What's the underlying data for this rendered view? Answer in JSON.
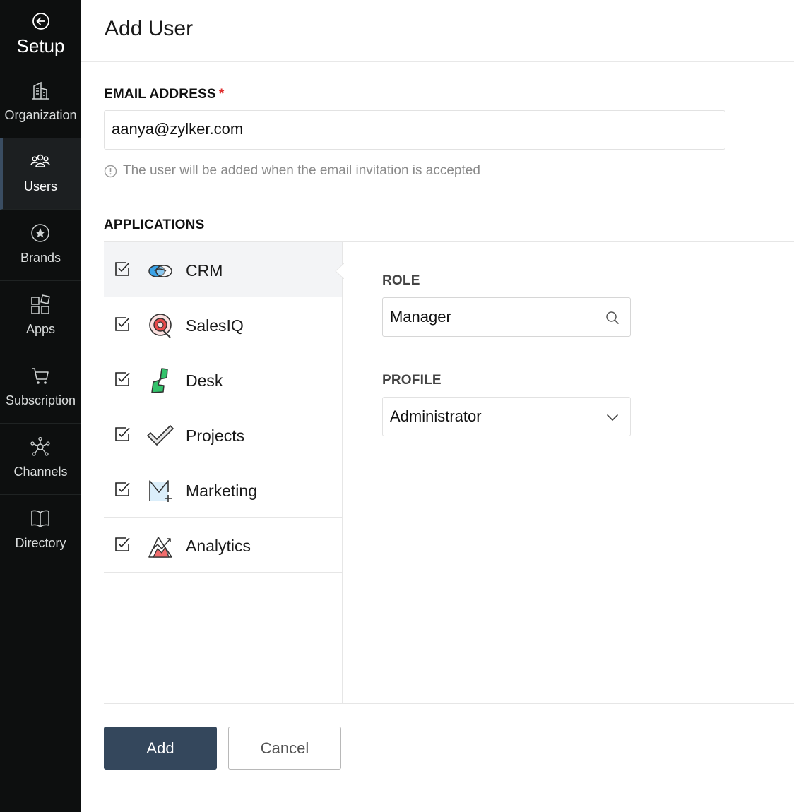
{
  "sidebar": {
    "setup_label": "Setup",
    "items": [
      {
        "label": "Organization",
        "icon": "building-icon"
      },
      {
        "label": "Users",
        "icon": "users-icon",
        "active": true
      },
      {
        "label": "Brands",
        "icon": "star-badge-icon"
      },
      {
        "label": "Apps",
        "icon": "apps-grid-icon"
      },
      {
        "label": "Subscription",
        "icon": "cart-icon"
      },
      {
        "label": "Channels",
        "icon": "network-icon"
      },
      {
        "label": "Directory",
        "icon": "book-icon"
      }
    ]
  },
  "header": {
    "title": "Add User"
  },
  "email": {
    "label": "EMAIL ADDRESS",
    "required_mark": "*",
    "value": "aanya@zylker.com",
    "hint": "The user will be added when the email invitation is accepted"
  },
  "applications": {
    "label": "APPLICATIONS",
    "items": [
      {
        "name": "CRM",
        "checked": true,
        "active": true
      },
      {
        "name": "SalesIQ",
        "checked": true
      },
      {
        "name": "Desk",
        "checked": true
      },
      {
        "name": "Projects",
        "checked": true
      },
      {
        "name": "Marketing",
        "checked": true
      },
      {
        "name": "Analytics",
        "checked": true
      }
    ]
  },
  "role": {
    "label": "ROLE",
    "value": "Manager"
  },
  "profile": {
    "label": "PROFILE",
    "value": "Administrator"
  },
  "actions": {
    "add": "Add",
    "cancel": "Cancel"
  },
  "colors": {
    "sidebar_bg": "#0d0f0f",
    "primary_button": "#34475c",
    "required": "#e03131"
  }
}
